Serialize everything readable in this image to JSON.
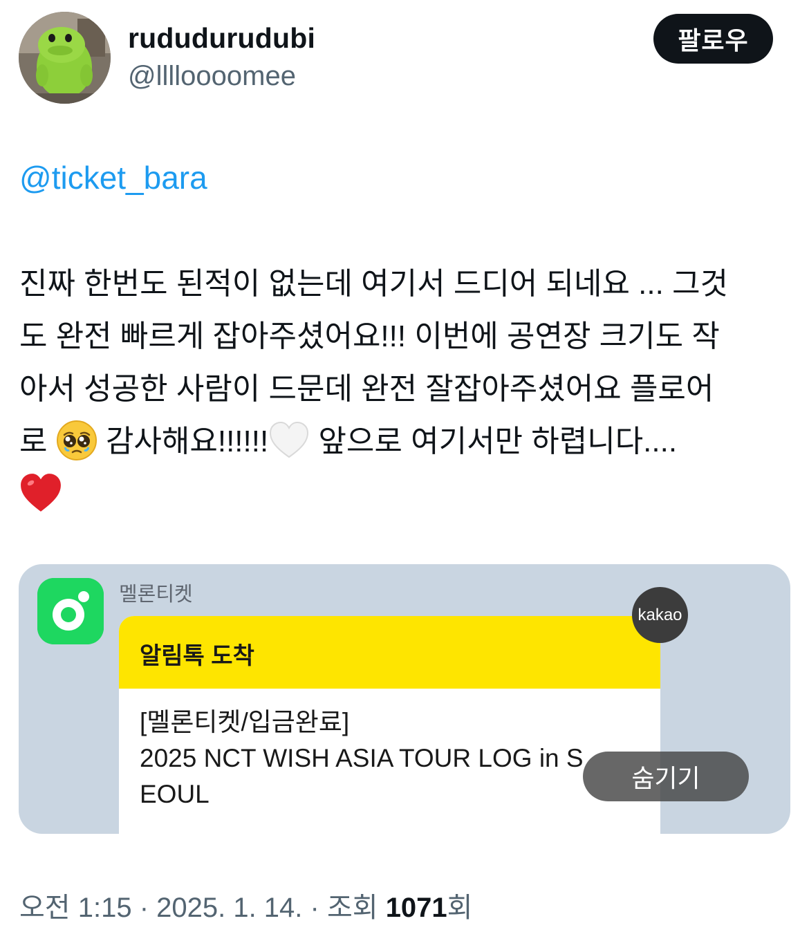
{
  "author": {
    "display_name": "rududurudubi",
    "handle": "@lllloooomee",
    "avatar_icon": "green-plush-mascot-avatar"
  },
  "follow_button": {
    "label": "팔로우"
  },
  "tweet": {
    "mention": "@ticket_bara",
    "lines": [
      "진짜 한번도 된적이 없는데 여기서 드디어 되네요 ... 그것",
      "도 완전 빠르게 잡아주셨어요!!! 이번에 공연장 크기도 작",
      "아서 성공한 사람이 드문데 완전 잘잡아주셨어요 플로어"
    ],
    "line4_start": "로 ",
    "line4_mid": " 감사해요!!!!!!",
    "line4_end": " 앞으로 여기서만 하렵니다....",
    "emoji_pleading": "pleading-face-emoji",
    "emoji_white_heart": "white-heart-emoji",
    "emoji_red_heart": "red-heart-emoji"
  },
  "media": {
    "app_icon": "melon-ticket-app-icon",
    "sender": "멜론티켓",
    "notification_title": "알림톡 도착",
    "message_line1": "[멜론티켓/입금완료]",
    "message_line2": "2025 NCT WISH ASIA TOUR LOG in S",
    "message_line3": "EOUL",
    "badge": "kakao",
    "hide_label": "숨기기",
    "colors": {
      "card_bg": "#c9d5e1",
      "kakao_yellow": "#fee500",
      "melon_green": "#1ed760"
    }
  },
  "meta": {
    "time": "오전 1:15",
    "separator1": " · ",
    "date": "2025. 1. 14.",
    "separator2": " · ",
    "views_label": "조회 ",
    "views_count": "1071",
    "views_suffix": "회"
  },
  "colors": {
    "link_blue": "#1d9bf0",
    "secondary_text": "#536471",
    "primary_text": "#0f1419"
  }
}
